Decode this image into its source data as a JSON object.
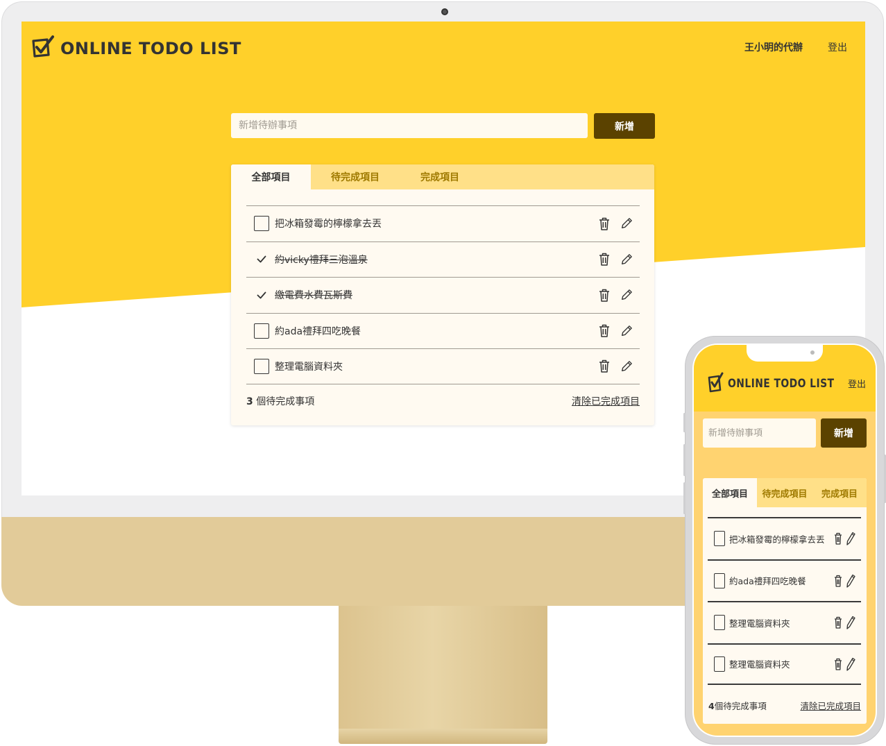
{
  "app": {
    "title": "ONLINE TODO LIST",
    "user_label": "王小明的代辦",
    "logout_label": "登出"
  },
  "input": {
    "placeholder": "新增待辦事項",
    "add_label": "新增"
  },
  "tabs": [
    {
      "label": "全部項目",
      "active": true
    },
    {
      "label": "待完成項目",
      "active": false
    },
    {
      "label": "完成項目",
      "active": false
    }
  ],
  "desktop": {
    "todos": [
      {
        "text": "把冰箱發霉的檸檬拿去丟",
        "done": false
      },
      {
        "text": "約vicky禮拜三泡溫泉",
        "done": true
      },
      {
        "text": "繳電費水費瓦斯費",
        "done": true
      },
      {
        "text": "約ada禮拜四吃晚餐",
        "done": false
      },
      {
        "text": "整理電腦資料夾",
        "done": false
      }
    ],
    "pending_count": "3",
    "pending_suffix": " 個待完成事項",
    "clear_label": "清除已完成項目"
  },
  "mobile": {
    "todos": [
      {
        "text": "把冰箱發霉的檸檬拿去丟",
        "done": false
      },
      {
        "text": "約ada禮拜四吃晚餐",
        "done": false
      },
      {
        "text": "整理電腦資料夾",
        "done": false
      },
      {
        "text": "整理電腦資料夾",
        "done": false
      }
    ],
    "pending_count": "4",
    "pending_suffix": "個待完成事項",
    "clear_label": "清除已完成項目"
  },
  "colors": {
    "accent": "#ffd02a",
    "button": "#5b4200",
    "card": "#fffaf1",
    "tab_bar": "#ffe088",
    "tab_inactive": "#9f7a00"
  },
  "icons": [
    "checkbox-logo-icon",
    "trash-icon",
    "pencil-icon",
    "checkmark-icon"
  ]
}
